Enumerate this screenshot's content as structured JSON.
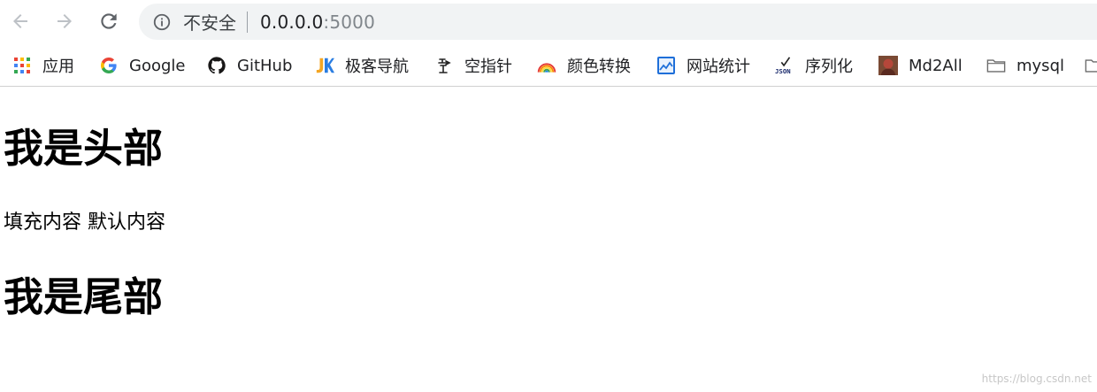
{
  "browser": {
    "security_label": "不安全",
    "url_host": "0.0.0.0",
    "url_port": ":5000",
    "icons": {
      "back": "arrow-left-icon",
      "forward": "arrow-right-icon",
      "reload": "reload-icon",
      "info": "info-circle-icon"
    }
  },
  "bookmarks": [
    {
      "label": "应用",
      "icon": "apps-grid-icon"
    },
    {
      "label": "Google",
      "icon": "google-icon"
    },
    {
      "label": "GitHub",
      "icon": "github-icon"
    },
    {
      "label": "极客导航",
      "icon": "jk-icon"
    },
    {
      "label": "空指针",
      "icon": "kongzhizhen-icon"
    },
    {
      "label": "颜色转换",
      "icon": "rainbow-icon"
    },
    {
      "label": "网站统计",
      "icon": "chart-icon"
    },
    {
      "label": "序列化",
      "icon": "json-icon"
    },
    {
      "label": "Md2All",
      "icon": "md2all-avatar-icon"
    },
    {
      "label": "mysql",
      "icon": "folder-icon"
    }
  ],
  "page": {
    "header": "我是头部",
    "content": "填充内容 默认内容",
    "footer": "我是尾部"
  },
  "watermark": "https://blog.csdn.net",
  "colors": {
    "omnibox_bg": "#f1f3f4",
    "toolbar_icon": "#5f6368",
    "google_blue": "#4285f4",
    "jk_blue": "#2a7de1",
    "folder_gray": "#6b6b6b"
  }
}
